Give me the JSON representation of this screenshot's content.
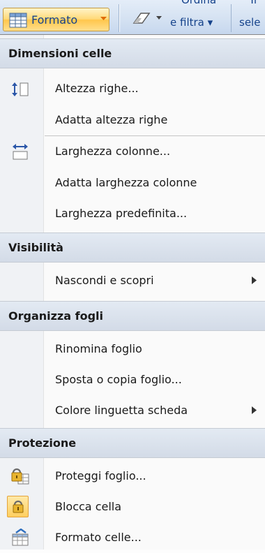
{
  "ribbon": {
    "format_label": "Formato",
    "ordina_top": "Ordina",
    "ordina_bottom": "e filtra ▾",
    "trova_top": "Tr",
    "trova_bottom": "sele"
  },
  "menu": {
    "sections": [
      {
        "header": "Dimensioni celle",
        "items": [
          {
            "label": "Altezza righe...",
            "icon": "row-height-icon"
          },
          {
            "label": "Adatta altezza righe"
          },
          {
            "label": "Larghezza colonne...",
            "icon": "column-width-icon"
          },
          {
            "label": "Adatta larghezza colonne"
          },
          {
            "label": "Larghezza predefinita..."
          }
        ]
      },
      {
        "header": "Visibilità",
        "items": [
          {
            "label": "Nascondi e scopri",
            "submenu": true
          }
        ]
      },
      {
        "header": "Organizza fogli",
        "items": [
          {
            "label": "Rinomina foglio"
          },
          {
            "label": "Sposta o copia foglio..."
          },
          {
            "label": "Colore linguetta scheda",
            "submenu": true
          }
        ]
      },
      {
        "header": "Protezione",
        "items": [
          {
            "label": "Proteggi foglio...",
            "icon": "protect-sheet-icon"
          },
          {
            "label": "Blocca cella",
            "icon": "lock-icon",
            "toggled": true
          },
          {
            "label": "Formato celle...",
            "icon": "format-cells-icon"
          }
        ]
      }
    ]
  },
  "colors": {
    "ribbon_text": "#15428b",
    "header_bg": "#dde4ee",
    "highlight": "#ffcf5f"
  }
}
